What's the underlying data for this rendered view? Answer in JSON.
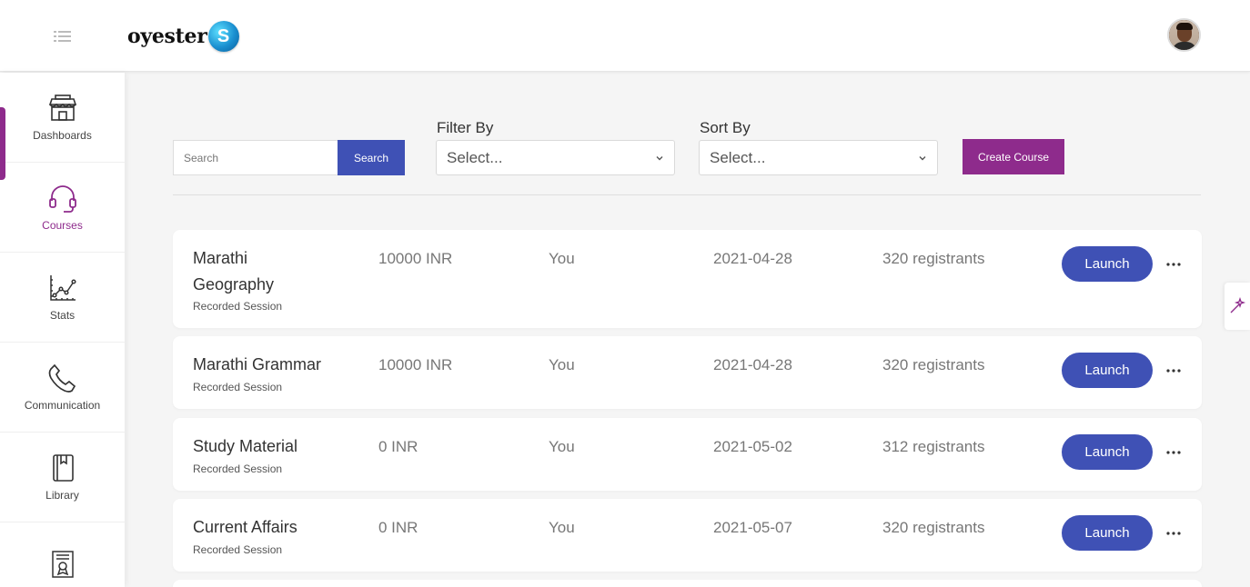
{
  "app": {
    "logo_text": "oyester",
    "logo_badge": "S"
  },
  "colors": {
    "primary": "#3f51b5",
    "accent": "#8e2b8c"
  },
  "sidebar": {
    "items": [
      {
        "label": "Dashboards",
        "icon": "store-icon",
        "active": false
      },
      {
        "label": "Courses",
        "icon": "headset-icon",
        "active": true
      },
      {
        "label": "Stats",
        "icon": "chart-icon",
        "active": false
      },
      {
        "label": "Communication",
        "icon": "phone-icon",
        "active": false
      },
      {
        "label": "Library",
        "icon": "book-icon",
        "active": false
      },
      {
        "label": "",
        "icon": "certificate-icon",
        "active": false
      }
    ]
  },
  "filters": {
    "search_placeholder": "Search",
    "search_button": "Search",
    "filter_label": "Filter By",
    "filter_value": "Select...",
    "sort_label": "Sort By",
    "sort_value": "Select...",
    "create_button": "Create Course"
  },
  "courses": [
    {
      "title_line1": "Marathi",
      "title_line2": "Geography",
      "type": "Recorded Session",
      "price": "10000 INR",
      "owner": "You",
      "date": "2021-04-28",
      "registrants": "320 registrants",
      "action": "Launch"
    },
    {
      "title": "Marathi Grammar",
      "type": "Recorded Session",
      "price": "10000 INR",
      "owner": "You",
      "date": "2021-04-28",
      "registrants": "320 registrants",
      "action": "Launch"
    },
    {
      "title": "Study Material",
      "type": "Recorded Session",
      "price": "0 INR",
      "owner": "You",
      "date": "2021-05-02",
      "registrants": "312 registrants",
      "action": "Launch"
    },
    {
      "title": "Current Affairs",
      "type": "Recorded Session",
      "price": "0 INR",
      "owner": "You",
      "date": "2021-05-07",
      "registrants": "320 registrants",
      "action": "Launch"
    }
  ]
}
